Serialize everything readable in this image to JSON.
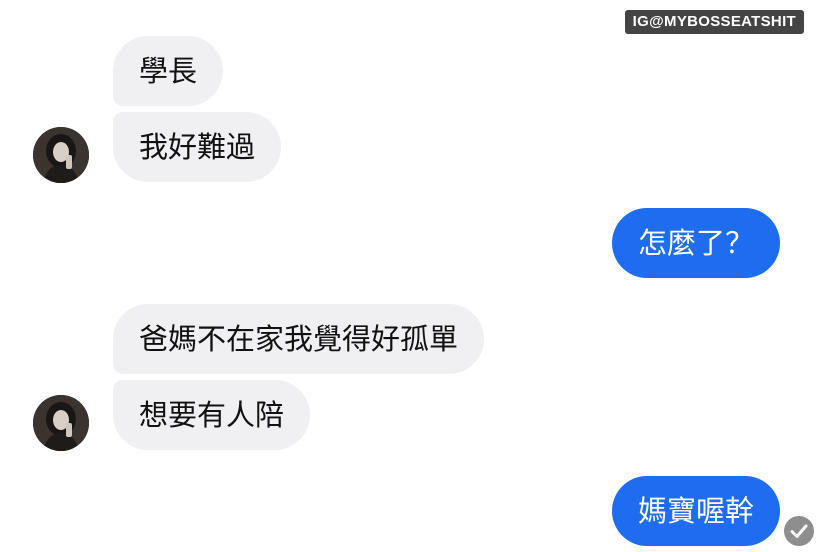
{
  "watermark": {
    "text": "IG@MYBOSSEATSHIT"
  },
  "conversation": {
    "messages": [
      {
        "sender": "other",
        "text": "學長"
      },
      {
        "sender": "other",
        "text": "我好難過"
      },
      {
        "sender": "me",
        "text": "怎麼了？"
      },
      {
        "sender": "other",
        "text": "爸媽不在家我覺得好孤單"
      },
      {
        "sender": "other",
        "text": "想要有人陪"
      },
      {
        "sender": "me",
        "text": "媽寶喔幹"
      }
    ]
  },
  "icons": {
    "avatar": "contact-avatar-photo",
    "read_receipt": "check-circle-icon"
  },
  "colors": {
    "outgoing_bubble": "#1e6cf0",
    "incoming_bubble": "#f0f0f2",
    "watermark_bg": "#444444",
    "read_receipt": "#8e8e8e"
  }
}
